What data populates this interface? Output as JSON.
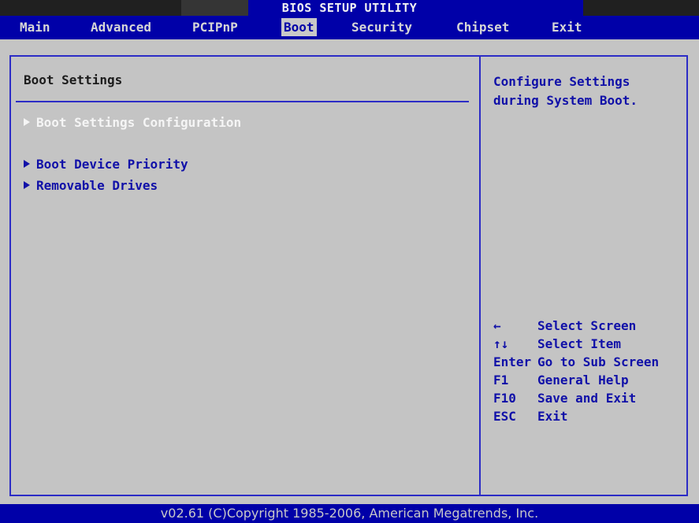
{
  "header": {
    "title": "BIOS SETUP UTILITY",
    "colors": {
      "bar": "#0000a8",
      "segment_dark_1": "#202020",
      "segment_dark_2": "#353535",
      "segment_dark_3": "#202020",
      "text": "#f2f2f2"
    }
  },
  "menu": {
    "items": [
      {
        "label": "Main"
      },
      {
        "label": "Advanced"
      },
      {
        "label": "PCIPnP"
      },
      {
        "label": "Boot",
        "active": true
      },
      {
        "label": "Security"
      },
      {
        "label": "Chipset"
      },
      {
        "label": "Exit"
      }
    ]
  },
  "main": {
    "section_title": "Boot Settings",
    "entries": [
      {
        "label": "Boot Settings Configuration",
        "selected": true,
        "icon": "triangle-right-icon"
      },
      {
        "label": "Boot Device Priority",
        "icon": "triangle-right-icon"
      },
      {
        "label": "Removable Drives",
        "icon": "triangle-right-icon"
      }
    ]
  },
  "help": {
    "lines": [
      "Configure Settings",
      "during System Boot."
    ],
    "keys": [
      {
        "key": "←",
        "desc": "Select Screen"
      },
      {
        "key": "↑↓",
        "desc": "Select Item"
      },
      {
        "key": "Enter",
        "desc": "Go to Sub Screen"
      },
      {
        "key": "F1",
        "desc": "General Help"
      },
      {
        "key": "F10",
        "desc": "Save and Exit"
      },
      {
        "key": "ESC",
        "desc": "Exit"
      }
    ]
  },
  "footer": {
    "text": "v02.61 (C)Copyright 1985-2006, American Megatrends, Inc."
  },
  "colors": {
    "panel": "#c4c4c4",
    "border": "#2c2cc6",
    "item_text": "#1010a8",
    "selected_text": "#f5f5f5"
  }
}
